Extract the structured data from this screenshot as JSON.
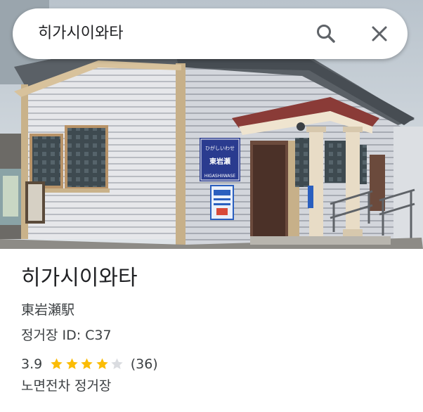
{
  "search": {
    "query": "히가시이와타",
    "search_icon": "search-icon",
    "close_icon": "close-icon"
  },
  "place": {
    "title": "히가시이와타",
    "native_name": "東岩瀬駅",
    "stop_id": "정거장 ID: C37",
    "rating": "3.9",
    "rating_stars": 3.9,
    "review_count": "(36)",
    "category": "노면전차 정거장"
  },
  "photo": {
    "station_sign_kana": "ひがしいわせ",
    "station_sign_kanji": "東岩瀬",
    "station_sign_roman": "HIGASHIIWASE"
  },
  "colors": {
    "star_filled": "#fbbc04",
    "star_empty": "#dadce0",
    "text_primary": "#202124",
    "text_secondary": "#3c4043"
  }
}
